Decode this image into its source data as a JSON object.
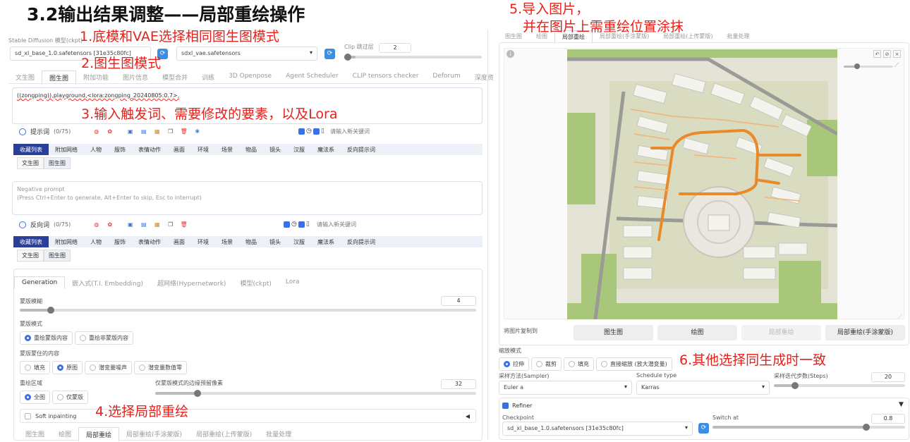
{
  "title": "3.2输出结果调整——局部重绘操作",
  "annotations": {
    "a1": "1.底模和VAE选择相同图生图模式",
    "a2": "2.图生图模式",
    "a3": "3.输入触发词、需要修改的要素，以及Lora",
    "a4": "4.选择局部重绘",
    "a5_line1": "5.导入图片，",
    "a5_line2": "并在图片上需重绘位置涂抹",
    "a6": "6.其他选择同生成时一致"
  },
  "top": {
    "model_label": "Stable Diffusion 模型(ckpt)",
    "model_value": "sd_xl_base_1.0.safetensors [31e35c80fc]",
    "vae_value": "sdxl_vae.safetensors",
    "clip_label": "Clip 跳过层",
    "clip_value": "2",
    "tabs": [
      "文生图",
      "图生图",
      "附加功能",
      "图片信息",
      "模型合并",
      "训练",
      "3D Openpose",
      "Agent Scheduler",
      "CLIP tensors checker",
      "Deforum",
      "深度资"
    ]
  },
  "prompt": {
    "text": "((zongping)),playground,<lora:zongping_20240805:0.7>,",
    "label": "提示词",
    "count": "(0/75)",
    "keyword_placeholder": "请输入新关键词"
  },
  "tag_tabs": [
    "收藏列表",
    "附加网络",
    "人物",
    "服饰",
    "表情动作",
    "画面",
    "环境",
    "场景",
    "物品",
    "镜头",
    "汉服",
    "魔法系",
    "反向提示词"
  ],
  "sub_tabs": [
    "文生图",
    "图生图"
  ],
  "negative": {
    "line1": "Negative prompt",
    "line2": "(Press Ctrl+Enter to generate, Alt+Enter to skip, Esc to interrupt)",
    "label": "反向词",
    "count": "(0/75)",
    "keyword_placeholder": "请输入新关键词"
  },
  "gen_tabs": [
    "Generation",
    "嵌入式(T.I. Embedding)",
    "超网络(Hypernetwork)",
    "模型(ckpt)",
    "Lora"
  ],
  "mask_blur": {
    "label": "蒙版模糊",
    "value": "4"
  },
  "mask_mode": {
    "label": "蒙版模式",
    "options": [
      "重绘蒙版内容",
      "重绘非蒙版内容"
    ]
  },
  "masked_content": {
    "label": "蒙版蒙住的内容",
    "options": [
      "填充",
      "原图",
      "潜变量噪声",
      "潜变量数值零"
    ]
  },
  "inpaint_area": {
    "label": "重绘区域",
    "options": [
      "全图",
      "仅蒙版"
    ]
  },
  "padding": {
    "label": "仅蒙版模式的边缘预留像素",
    "value": "32"
  },
  "soft_inpainting": "Soft inpainting",
  "bottom_tabs": [
    "图生图",
    "绘图",
    "局部重绘",
    "局部重绘(手涂蒙版)",
    "局部重绘(上传蒙版)",
    "批量处理"
  ],
  "right_tabs": [
    "图生图",
    "绘图",
    "局部重绘",
    "局部重绘(手涂蒙版)",
    "局部重绘(上传蒙版)",
    "批量处理"
  ],
  "copy_label": "将图片复制到",
  "copy_buttons": [
    "图生图",
    "绘图",
    "局部重绘",
    "局部重绘(手涂蒙版)"
  ],
  "resize_mode": {
    "label": "缩放模式",
    "options": [
      "拉伸",
      "裁剪",
      "填充",
      "直接缩放 (放大潜变量)"
    ]
  },
  "sampler": {
    "label": "采样方法(Sampler)",
    "value": "Euler a"
  },
  "schedule": {
    "label": "Schedule type",
    "value": "Karras"
  },
  "steps": {
    "label": "采样迭代步数(Steps)",
    "value": "20"
  },
  "refiner": {
    "label": "Refiner",
    "checkpoint_label": "Checkpoint",
    "checkpoint_value": "sd_xl_base_1.0.safetensors [31e35c80fc]",
    "switch_label": "Switch at",
    "switch_value": "0.8"
  },
  "sliders": {
    "mask_blur": 0.07,
    "padding": 0.13,
    "switch_at": 0.8,
    "clip": 0.1
  },
  "colors": {
    "accent": "#3a6fe6",
    "annotation": "#e8201a",
    "tag_selected": "#2a3f97"
  }
}
